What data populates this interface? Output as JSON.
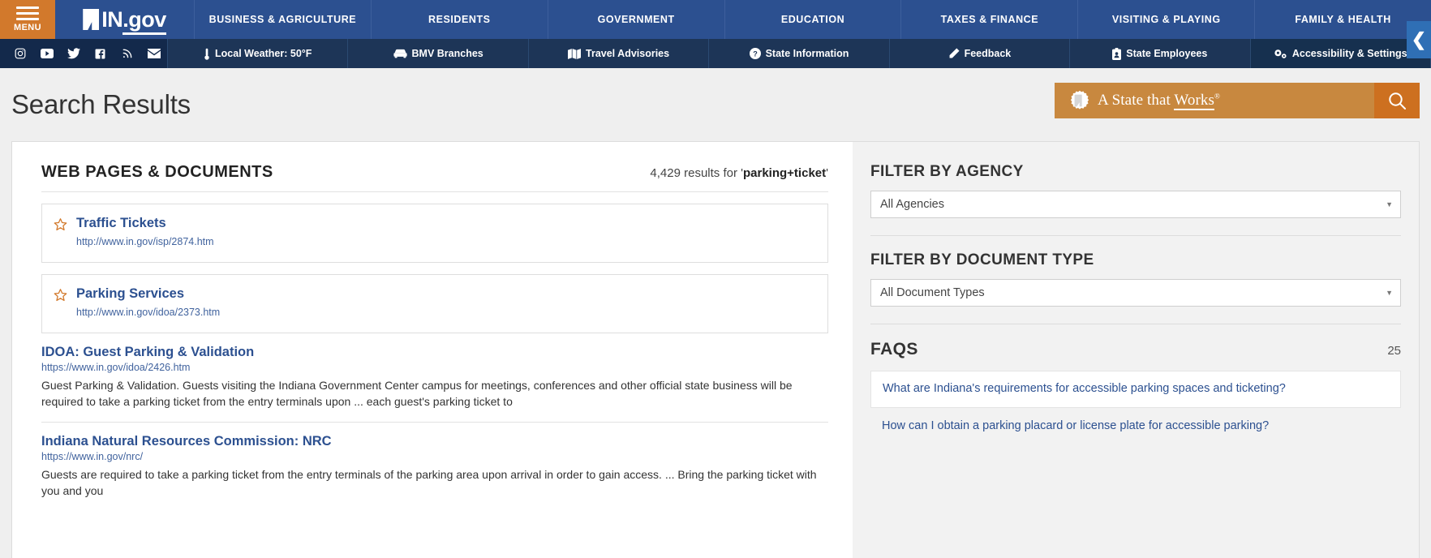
{
  "header": {
    "menu_label": "MENU",
    "brand": {
      "in": "IN",
      "dot_gov": ".gov"
    },
    "nav_items": [
      {
        "label": "BUSINESS & AGRICULTURE"
      },
      {
        "label": "RESIDENTS"
      },
      {
        "label": "GOVERNMENT"
      },
      {
        "label": "EDUCATION"
      },
      {
        "label": "TAXES & FINANCE"
      },
      {
        "label": "VISITING & PLAYING"
      },
      {
        "label": "FAMILY & HEALTH"
      }
    ],
    "edge_tab_icon": "chevron-left-icon"
  },
  "utility_bar": {
    "social_icons": [
      {
        "name": "instagram-icon"
      },
      {
        "name": "youtube-icon"
      },
      {
        "name": "twitter-icon"
      },
      {
        "name": "facebook-icon"
      },
      {
        "name": "rss-icon"
      },
      {
        "name": "email-icon"
      }
    ],
    "items": [
      {
        "label": "Local Weather: 50°F",
        "icon": "thermometer-icon"
      },
      {
        "label": "BMV Branches",
        "icon": "car-icon"
      },
      {
        "label": "Travel Advisories",
        "icon": "map-icon"
      },
      {
        "label": "State Information",
        "icon": "question-circle-icon"
      },
      {
        "label": "Feedback",
        "icon": "pencil-icon"
      },
      {
        "label": "State Employees",
        "icon": "id-badge-icon"
      },
      {
        "label": "Accessibility & Settings",
        "icon": "gears-icon"
      }
    ]
  },
  "page": {
    "title": "Search Results",
    "banner": {
      "text_a": "A State that ",
      "text_works": "Works",
      "registered": "®",
      "logo_icon": "gear-indiana-icon",
      "search_icon": "search-icon"
    }
  },
  "results": {
    "heading": "WEB PAGES & DOCUMENTS",
    "count_prefix": "4,429 results for '",
    "query": "parking+ticket",
    "count_suffix": "'",
    "featured": [
      {
        "title": "Traffic Tickets",
        "url": "http://www.in.gov/isp/2874.htm",
        "star_icon": "star-outline-icon"
      },
      {
        "title": "Parking Services",
        "url": "http://www.in.gov/idoa/2373.htm",
        "star_icon": "star-outline-icon"
      }
    ],
    "items": [
      {
        "title": "IDOA: Guest Parking & Validation",
        "url": "https://www.in.gov/idoa/2426.htm",
        "description": "Guest Parking & Validation. Guests visiting the Indiana Government Center campus for meetings, conferences and other official state business will be required to take a parking ticket from the entry terminals upon ... each guest's parking ticket to"
      },
      {
        "title": "Indiana Natural Resources Commission: NRC",
        "url": "https://www.in.gov/nrc/",
        "description": "Guests are required to take a parking ticket from the entry terminals of the parking area upon arrival in order to gain access. ... Bring the parking ticket with you and you"
      }
    ]
  },
  "sidebar": {
    "agency_filter": {
      "title": "FILTER BY AGENCY",
      "value": "All Agencies",
      "caret_icon": "chevron-down-icon"
    },
    "doctype_filter": {
      "title": "FILTER BY DOCUMENT TYPE",
      "value": "All Document Types",
      "caret_icon": "chevron-down-icon"
    },
    "faqs": {
      "title": "FAQS",
      "count": "25",
      "items": [
        {
          "question": "What are Indiana's requirements for accessible parking spaces and ticketing?"
        },
        {
          "question": "How can I obtain a parking placard or license plate for accessible parking?"
        }
      ]
    }
  }
}
